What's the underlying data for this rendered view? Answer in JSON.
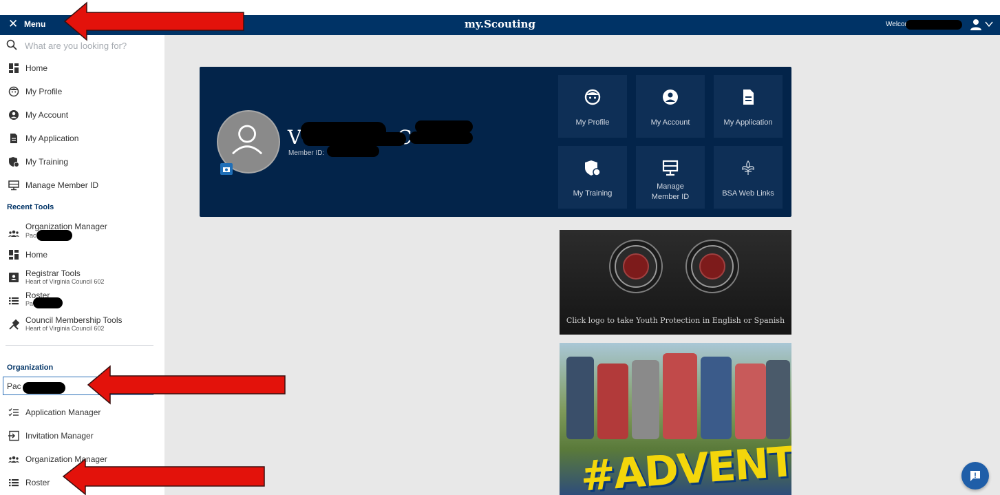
{
  "app": {
    "title": "my.Scouting",
    "welcome": "Welcome"
  },
  "menu": {
    "header": "Menu",
    "search_placeholder": "What are you looking for?",
    "items": [
      {
        "label": "Home",
        "icon": "dashboard-icon"
      },
      {
        "label": "My Profile",
        "icon": "face-icon"
      },
      {
        "label": "My Account",
        "icon": "account-circle-icon"
      },
      {
        "label": "My Application",
        "icon": "document-icon"
      },
      {
        "label": "My Training",
        "icon": "training-shield-icon"
      },
      {
        "label": "Manage Member ID",
        "icon": "member-card-icon"
      }
    ],
    "recent_tools_title": "Recent Tools",
    "recent_tools": [
      {
        "label": "Organization Manager",
        "sub": "Pac",
        "icon": "group-icon"
      },
      {
        "label": "Home",
        "sub": "",
        "icon": "dashboard-icon"
      },
      {
        "label": "Registrar Tools",
        "sub": "Heart of Virginia Council 602",
        "icon": "id-badge-icon"
      },
      {
        "label": "Roster",
        "sub": "Pa",
        "icon": "list-icon"
      },
      {
        "label": "Council Membership Tools",
        "sub": "Heart of Virginia Council 602",
        "icon": "tools-icon"
      }
    ],
    "organization_title": "Organization",
    "organization_value": "Pac",
    "org_items": [
      {
        "label": "Application Manager",
        "icon": "checklist-icon"
      },
      {
        "label": "Invitation Manager",
        "icon": "invitation-icon"
      },
      {
        "label": "Organization Manager",
        "icon": "group-icon"
      },
      {
        "label": "Roster",
        "icon": "list-icon"
      }
    ]
  },
  "profile": {
    "name_first_initial": "V",
    "name_fragment": "C",
    "member_id_label": "Member ID:",
    "tiles": [
      {
        "label": "My Profile",
        "icon": "face-icon"
      },
      {
        "label": "My Account",
        "icon": "account-circle-icon"
      },
      {
        "label": "My Application",
        "icon": "document-icon"
      },
      {
        "label": "My Training",
        "icon": "training-shield-icon"
      },
      {
        "label": "Manage Member ID",
        "icon": "member-card-icon"
      },
      {
        "label": "BSA Web Links",
        "icon": "fleur-de-lis-icon"
      }
    ]
  },
  "banners": {
    "youth_protection_caption": "Click logo to take Youth Protection in English or Spanish",
    "adventure_tag": "#ADVENTUREON!"
  },
  "colors": {
    "navy": "#003366",
    "card": "#03244a",
    "tile": "#0e2f56",
    "annotation_red": "#e3120b"
  }
}
